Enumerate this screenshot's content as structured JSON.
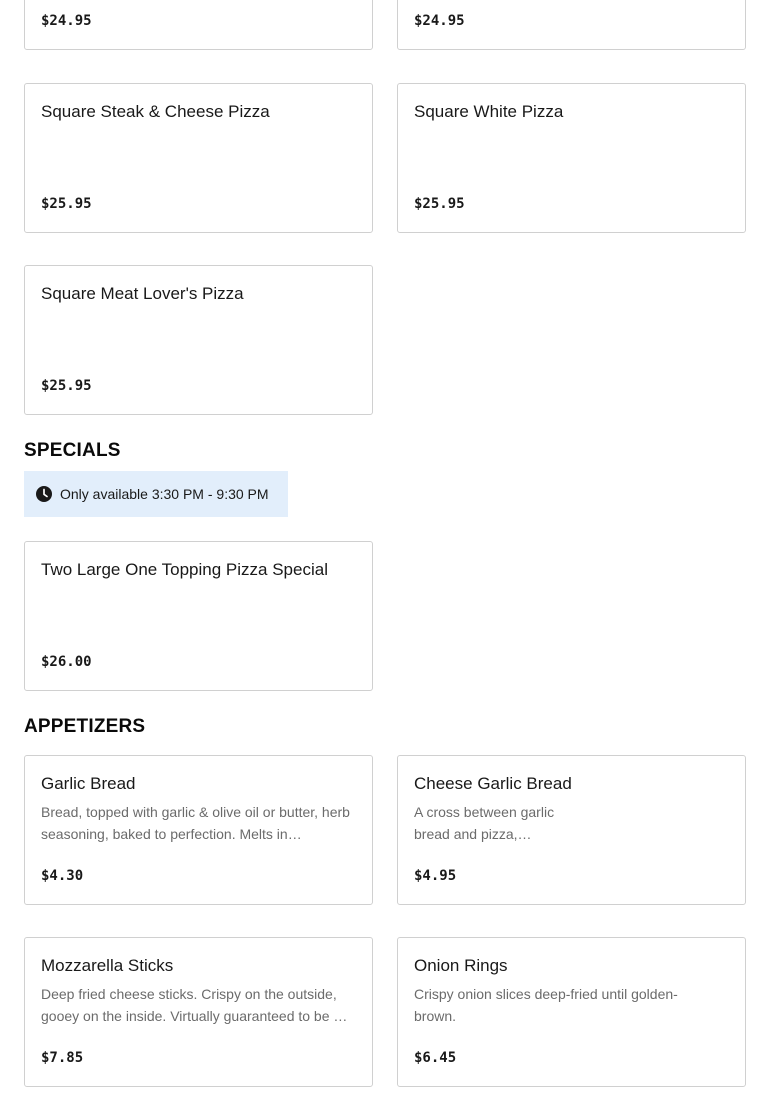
{
  "top_row": [
    {
      "price": "$24.95"
    },
    {
      "price": "$24.95"
    }
  ],
  "pizza_items": [
    {
      "name": "Square Steak & Cheese Pizza",
      "price": "$25.95"
    },
    {
      "name": "Square White Pizza",
      "price": "$25.95"
    },
    {
      "name": "Square Meat Lover's Pizza",
      "price": "$25.95"
    }
  ],
  "specials": {
    "title": "SPECIALS",
    "availability": "Only available 3:30 PM - 9:30 PM",
    "items": [
      {
        "name": "Two Large One Topping Pizza Special",
        "price": "$26.00"
      }
    ]
  },
  "appetizers": {
    "title": "APPETIZERS",
    "items": [
      {
        "name": "Garlic Bread",
        "description": "Bread, topped with garlic & olive oil or butter, herb seasoning, baked to perfection. Melts in…",
        "price": "$4.30"
      },
      {
        "name": "Cheese Garlic Bread",
        "description": "A cross between garlic bread and pizza, cheesy…",
        "price": "$4.95"
      },
      {
        "name": "Mozzarella Sticks",
        "description": "Deep fried cheese sticks. Crispy on the outside, gooey on the inside. Virtually guaranteed to be …",
        "price": "$7.85"
      },
      {
        "name": "Onion Rings",
        "description": "Crispy onion slices deep-fried until golden-brown.",
        "price": "$6.45"
      }
    ]
  }
}
